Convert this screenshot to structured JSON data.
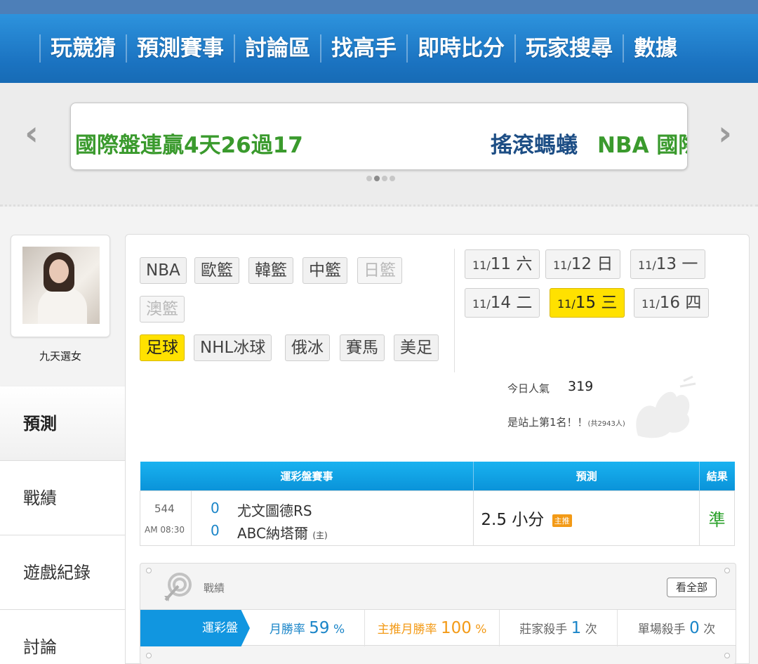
{
  "nav": {
    "items": [
      "玩競猜",
      "預測賽事",
      "討論區",
      "找高手",
      "即時比分",
      "玩家搜尋",
      "數據"
    ]
  },
  "banner": {
    "ticker_a": "國際盤連贏4天26過17",
    "ticker_b1": "搖滾螞蟻",
    "ticker_b2": "NBA 國際",
    "left_arrow": "‹",
    "right_arrow": "›"
  },
  "profile": {
    "username": "九天選女"
  },
  "side_menu": [
    "預測",
    "戰績",
    "遊戲紀錄",
    "討論"
  ],
  "categories": {
    "row1": [
      "NBA",
      "歐籃",
      "韓籃",
      "中籃",
      "日籃"
    ],
    "row2": [
      "澳籃"
    ],
    "row3": [
      "足球",
      "NHL冰球",
      "俄冰",
      "賽馬",
      "美足"
    ],
    "selected": "足球",
    "disabled": [
      "日籃",
      "澳籃"
    ]
  },
  "dates": [
    {
      "md": "11/",
      "d": "11",
      "w": "六"
    },
    {
      "md": "11/",
      "d": "12",
      "w": "日"
    },
    {
      "md": "11/",
      "d": "13",
      "w": "一"
    },
    {
      "md": "11/",
      "d": "14",
      "w": "二"
    },
    {
      "md": "11/",
      "d": "15",
      "w": "三"
    },
    {
      "md": "11/",
      "d": "16",
      "w": "四"
    }
  ],
  "popularity": {
    "label": "今日人氣",
    "value": "319",
    "rank_text": "是站上第1名！！",
    "rank_total": "(共2943人)"
  },
  "table": {
    "headers": [
      "運彩盤賽事",
      "預測",
      "結果"
    ],
    "game": {
      "no": "544",
      "time": "AM 08:30",
      "score1": "0",
      "team1": "尤文圖德RS",
      "score2": "0",
      "team2": "ABC納塔爾",
      "team2_tag": "(主)",
      "pick": "2.5 小分",
      "pick_badge": "主推",
      "result": "準"
    }
  },
  "record": {
    "title": "戰績",
    "view_all": "看全部",
    "tab": "運彩盤",
    "month_win_label": "月勝率",
    "month_win_value": "59",
    "main_win_label": "主推月勝率",
    "main_win_value": "100",
    "pct": "%",
    "dealer_kill_label": "莊家殺手",
    "dealer_kill_value": "1",
    "single_kill_label": "單場殺手",
    "single_kill_value": "0",
    "times": "次"
  },
  "colors": {
    "nav_blue": "#1b73c1",
    "accent_blue": "#1196e0",
    "highlight_yellow": "#ffe100",
    "green": "#3a9a2d",
    "orange": "#f39a16"
  }
}
